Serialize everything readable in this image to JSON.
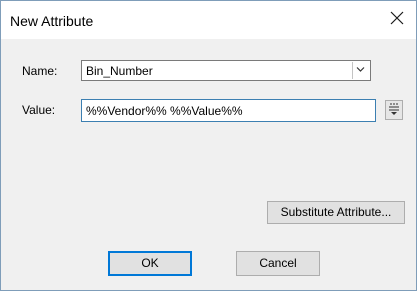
{
  "window": {
    "title": "New Attribute"
  },
  "name_field": {
    "label": "Name:",
    "value": "Bin_Number"
  },
  "value_field": {
    "label": "Value:",
    "value": "%%Vendor%% %%Value%%"
  },
  "buttons": {
    "substitute": "Substitute Attribute...",
    "ok": "OK",
    "cancel": "Cancel"
  },
  "icons": {
    "close": "close-icon",
    "dropdown": "chevron-down-icon",
    "insert": "insert-options-icon"
  }
}
